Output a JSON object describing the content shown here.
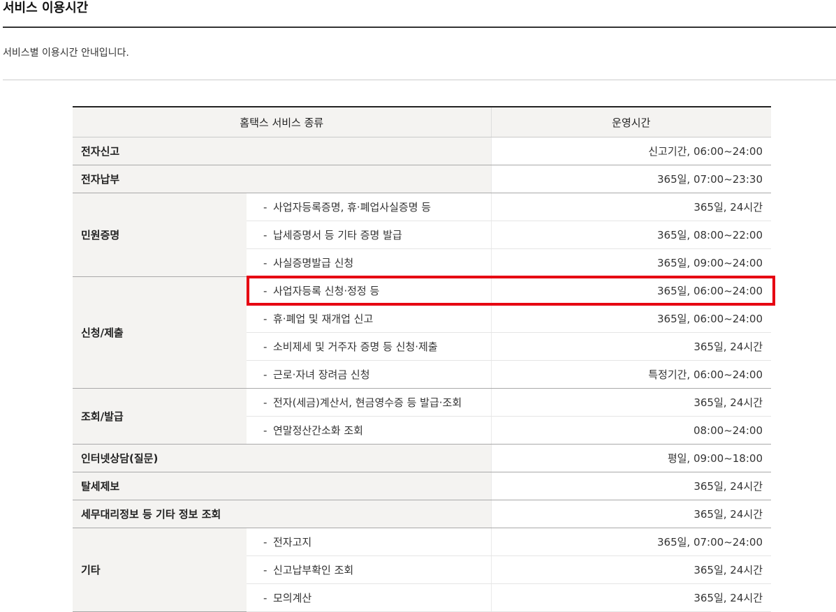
{
  "page": {
    "title": "서비스 이용시간",
    "description": "서비스별 이용시간 안내입니다."
  },
  "table": {
    "headers": {
      "service": "홈택스 서비스 종류",
      "hours": "운영시간"
    },
    "dash": "-",
    "rows": [
      {
        "category": "전자신고",
        "item": "",
        "hours": "신고기간, 06:00~24:00"
      },
      {
        "category": "전자납부",
        "item": "",
        "hours": "365일, 07:00~23:30"
      },
      {
        "category": "민원증명",
        "item": "사업자등록증명, 휴·폐업사실증명 등",
        "hours": "365일, 24시간"
      },
      {
        "category": "",
        "item": "납세증명서 등 기타 증명 발급",
        "hours": "365일, 08:00~22:00"
      },
      {
        "category": "",
        "item": "사실증명발급 신청",
        "hours": "365일, 09:00~24:00"
      },
      {
        "category": "신청/제출",
        "item": "사업자등록 신청·정정 등",
        "hours": "365일, 06:00~24:00"
      },
      {
        "category": "",
        "item": "휴·폐업 및 재개업 신고",
        "hours": "365일, 06:00~24:00"
      },
      {
        "category": "",
        "item": "소비제세 및 거주자 증명 등 신청·제출",
        "hours": "365일, 24시간"
      },
      {
        "category": "",
        "item": "근로·자녀 장려금 신청",
        "hours": "특정기간, 06:00~24:00"
      },
      {
        "category": "조회/발급",
        "item": "전자(세금)계산서, 현금영수증 등 발급·조회",
        "hours": "365일, 24시간"
      },
      {
        "category": "",
        "item": "연말정산간소화 조회",
        "hours": "08:00~24:00"
      },
      {
        "category": "인터넷상담(질문)",
        "item": "",
        "hours": "평일, 09:00~18:00"
      },
      {
        "category": "탈세제보",
        "item": "",
        "hours": "365일, 24시간"
      },
      {
        "category": "세무대리정보 등 기타 정보 조회",
        "item": "",
        "hours": "365일, 24시간"
      },
      {
        "category": "기타",
        "item": "전자고지",
        "hours": "365일, 07:00~24:00"
      },
      {
        "category": "",
        "item": "신고납부확인 조회",
        "hours": "365일, 24시간"
      },
      {
        "category": "",
        "item": "모의계산",
        "hours": "365일, 24시간"
      }
    ]
  },
  "colors": {
    "highlight": "#e60012",
    "category_bg": "#f4f3f1",
    "header_border": "#222222"
  }
}
